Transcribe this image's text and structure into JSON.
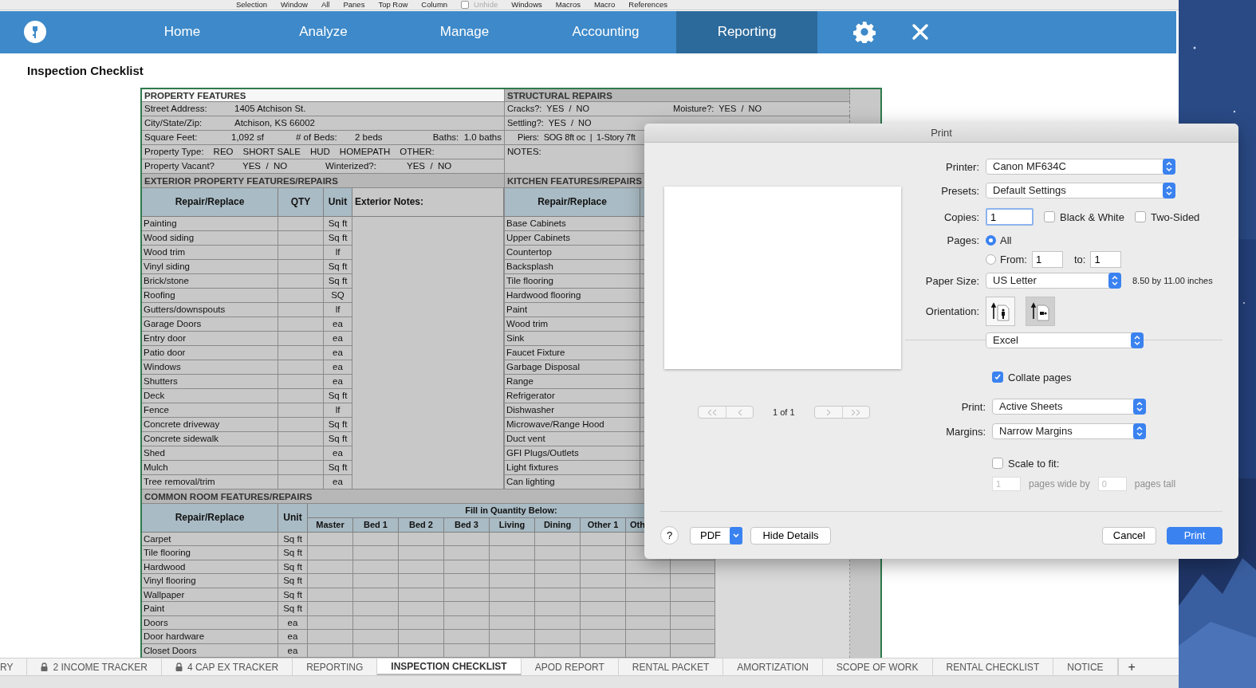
{
  "ribbon_labels": [
    {
      "text": "Selection",
      "kind": "label",
      "disabled": false
    },
    {
      "text": "Window",
      "kind": "label",
      "disabled": false
    },
    {
      "text": "All",
      "kind": "label",
      "disabled": false
    },
    {
      "text": "Panes",
      "kind": "label",
      "disabled": false
    },
    {
      "text": "Top Row",
      "kind": "label",
      "disabled": false
    },
    {
      "text": "Column",
      "kind": "label",
      "disabled": false
    },
    {
      "text": "Unhide",
      "kind": "checkbox",
      "disabled": true,
      "checked": false
    },
    {
      "text": "Windows",
      "kind": "label",
      "disabled": false
    },
    {
      "text": "Macros",
      "kind": "label",
      "disabled": false
    },
    {
      "text": "Macro",
      "kind": "label",
      "disabled": false
    },
    {
      "text": "References",
      "kind": "label",
      "disabled": false
    }
  ],
  "nav": {
    "items": [
      {
        "label": "Home",
        "selected": false
      },
      {
        "label": "Analyze",
        "selected": false
      },
      {
        "label": "Manage",
        "selected": false
      },
      {
        "label": "Accounting",
        "selected": false
      },
      {
        "label": "Reporting",
        "selected": true
      }
    ]
  },
  "page_title": "Inspection Checklist",
  "sheet": {
    "property_features": {
      "title": "PROPERTY FEATURES",
      "lines": [
        {
          "texts": [
            "Street Address:",
            "1405 Atchison St."
          ]
        },
        {
          "texts": [
            "City/State/Zip:",
            "Atchison, KS 66002"
          ]
        },
        {
          "texts": [
            "Square Feet:",
            "1,092 sf",
            "# of Beds:",
            "2 beds",
            "Baths:  1.0 baths"
          ]
        },
        {
          "texts": [
            "Property Type:",
            "REO",
            "SHORT SALE",
            "HUD",
            "HOMEPATH",
            "OTHER:"
          ]
        },
        {
          "texts": [
            "Property Vacant?",
            "YES  /  NO",
            "Winterized?:",
            "YES  /  NO"
          ]
        }
      ]
    },
    "structural_repairs": {
      "title": "STRUCTURAL REPAIRS",
      "lines": [
        {
          "texts": [
            "Cracks?:  YES  /  NO",
            "Moisture?:  YES  /  NO"
          ]
        },
        {
          "texts": [
            "Settling?:  YES  /  NO"
          ]
        },
        {
          "texts": [
            "Piers:  SOG 8ft oc  |  1-Story 7ft"
          ]
        }
      ],
      "notes_label": "NOTES:"
    },
    "exterior": {
      "title": "EXTERIOR PROPERTY FEATURES/REPAIRS",
      "columns": [
        "Repair/Replace",
        "QTY",
        "Unit",
        "Exterior Notes:"
      ],
      "rows": [
        {
          "item": "Painting",
          "unit": "Sq ft"
        },
        {
          "item": "Wood siding",
          "unit": "Sq ft"
        },
        {
          "item": "Wood trim",
          "unit": "lf"
        },
        {
          "item": "Vinyl siding",
          "unit": "Sq ft"
        },
        {
          "item": "Brick/stone",
          "unit": "Sq ft"
        },
        {
          "item": "Roofing",
          "unit": "SQ"
        },
        {
          "item": "Gutters/downspouts",
          "unit": "lf"
        },
        {
          "item": "Garage Doors",
          "unit": "ea"
        },
        {
          "item": "Entry door",
          "unit": "ea"
        },
        {
          "item": "Patio door",
          "unit": "ea"
        },
        {
          "item": "Windows",
          "unit": "ea"
        },
        {
          "item": "Shutters",
          "unit": "ea"
        },
        {
          "item": "Deck",
          "unit": "Sq ft"
        },
        {
          "item": "Fence",
          "unit": "lf"
        },
        {
          "item": "Concrete driveway",
          "unit": "Sq ft"
        },
        {
          "item": "Concrete sidewalk",
          "unit": "Sq ft"
        },
        {
          "item": "Shed",
          "unit": "ea"
        },
        {
          "item": "Mulch",
          "unit": "Sq ft"
        },
        {
          "item": "Tree removal/trim",
          "unit": "ea"
        }
      ]
    },
    "kitchen": {
      "title": "KITCHEN FEATURES/REPAIRS",
      "columns": [
        "Repair/Replace"
      ],
      "rows": [
        "Base Cabinets",
        "Upper Cabinets",
        "Countertop",
        "Backsplash",
        "Tile flooring",
        "Hardwood flooring",
        "Paint",
        "Wood trim",
        "Sink",
        "Faucet Fixture",
        "Garbage Disposal",
        "Range",
        "Refrigerator",
        "Dishwasher",
        "Microwave/Range Hood",
        "Duct vent",
        "GFI Plugs/Outlets",
        "Light fixtures",
        "Can lighting"
      ]
    },
    "common_room": {
      "title": "COMMON ROOM FEATURES/REPAIRS",
      "columns": [
        "Repair/Replace",
        "Unit"
      ],
      "group_heading": "Fill in Quantity Below:",
      "rooms": [
        "Master",
        "Bed 1",
        "Bed 2",
        "Bed 3",
        "Living",
        "Dining",
        "Other 1",
        "Oth"
      ],
      "rows": [
        {
          "item": "Carpet",
          "unit": "Sq ft"
        },
        {
          "item": "Tile flooring",
          "unit": "Sq ft"
        },
        {
          "item": "Hardwood",
          "unit": "Sq ft"
        },
        {
          "item": "Vinyl flooring",
          "unit": "Sq ft"
        },
        {
          "item": "Wallpaper",
          "unit": "Sq ft"
        },
        {
          "item": "Paint",
          "unit": "Sq ft"
        },
        {
          "item": "Doors",
          "unit": "ea"
        },
        {
          "item": "Door hardware",
          "unit": "ea"
        },
        {
          "item": "Closet Doors",
          "unit": "ea"
        }
      ]
    }
  },
  "print_dialog": {
    "title": "Print",
    "page_label": "1 of 1",
    "printer": {
      "label": "Printer:",
      "value": "Canon MF634C"
    },
    "presets": {
      "label": "Presets:",
      "value": "Default Settings"
    },
    "copies": {
      "label": "Copies:",
      "value": "1"
    },
    "options": [
      {
        "label": "Black & White",
        "checked": false
      },
      {
        "label": "Two-Sided",
        "checked": false
      }
    ],
    "pages": {
      "label": "Pages:",
      "choices": [
        {
          "label": "All",
          "selected": true
        },
        {
          "label": "From:",
          "selected": false
        }
      ],
      "from": "1",
      "to_label": "to:",
      "to": "1"
    },
    "paper_size": {
      "label": "Paper Size:",
      "value": "US Letter",
      "note": "8.50 by 11.00 inches"
    },
    "orientation": {
      "label": "Orientation:",
      "choices": [
        {
          "kind": "portrait",
          "selected": false
        },
        {
          "kind": "landscape",
          "selected": true
        }
      ]
    },
    "section": "Excel",
    "collate": {
      "label": "Collate pages",
      "checked": true
    },
    "print_what": {
      "label": "Print:",
      "value": "Active Sheets"
    },
    "margins": {
      "label": "Margins:",
      "value": "Narrow Margins"
    },
    "scale": {
      "label": "Scale to fit:",
      "checked": false,
      "wide": "1",
      "wide_label": "pages wide by",
      "tall": "0",
      "tall_label": "pages tall"
    },
    "footer": {
      "help": "?",
      "pdf": "PDF",
      "hide_details": "Hide Details",
      "cancel": "Cancel",
      "print": "Print"
    }
  },
  "sheet_tabs": [
    {
      "label": "RY",
      "locked": false,
      "selected": false
    },
    {
      "label": "2 INCOME TRACKER",
      "locked": true,
      "selected": false
    },
    {
      "label": "4 CAP EX TRACKER",
      "locked": true,
      "selected": false
    },
    {
      "label": "REPORTING",
      "locked": false,
      "selected": false
    },
    {
      "label": "INSPECTION CHECKLIST",
      "locked": false,
      "selected": true
    },
    {
      "label": "APOD REPORT",
      "locked": false,
      "selected": false
    },
    {
      "label": "RENTAL PACKET",
      "locked": false,
      "selected": false
    },
    {
      "label": "AMORTIZATION",
      "locked": false,
      "selected": false
    },
    {
      "label": "SCOPE OF WORK",
      "locked": false,
      "selected": false
    },
    {
      "label": "RENTAL CHECKLIST",
      "locked": false,
      "selected": false
    },
    {
      "label": "NOTICE",
      "locked": false,
      "selected": false
    }
  ],
  "add_sheet": "+"
}
